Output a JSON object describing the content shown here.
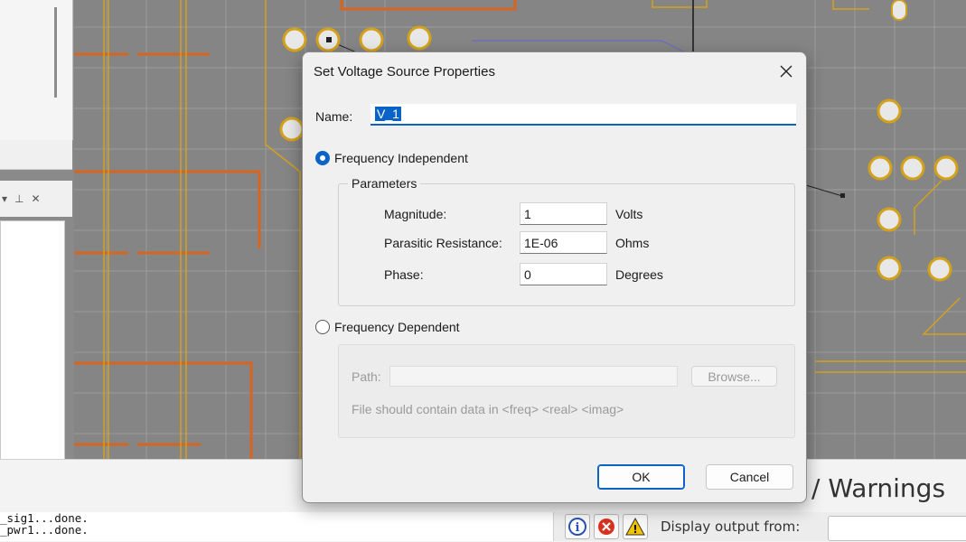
{
  "dialog": {
    "title": "Set Voltage Source Properties",
    "name_label": "Name:",
    "name_value": "V_1",
    "freq_independent_label": "Frequency Independent",
    "parameters_label": "Parameters",
    "magnitude_label": "Magnitude:",
    "magnitude_value": "1",
    "magnitude_unit": "Volts",
    "resistance_label": "Parasitic Resistance:",
    "resistance_value": "1E-06",
    "resistance_unit": "Ohms",
    "phase_label": "Phase:",
    "phase_value": "0",
    "phase_unit": "Degrees",
    "freq_dependent_label": "Frequency Dependent",
    "path_label": "Path:",
    "browse_label": "Browse...",
    "hint_text": "File should contain data in <freq> <real> <imag>",
    "ok_label": "OK",
    "cancel_label": "Cancel",
    "selected_mode": "Frequency Independent"
  },
  "background": {
    "log_lines": [
      "_sig1...done.",
      "_pwr1...done."
    ],
    "warnings_title": "/ Warnings",
    "display_output_label": "Display output from:"
  },
  "colors": {
    "accent": "#0a64c8",
    "trace_orange": "#d8651f",
    "trace_yellow": "#d4a21a",
    "pcb_bg": "#858585"
  }
}
